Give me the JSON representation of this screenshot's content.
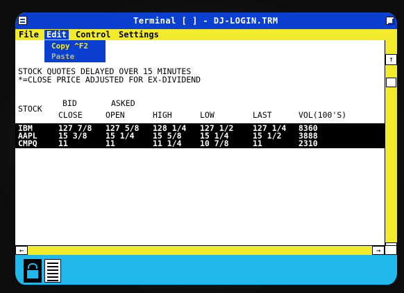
{
  "window": {
    "title": "Terminal  [  ] - DJ-LOGIN.TRM"
  },
  "menubar": {
    "items": [
      "File",
      "Edit",
      "Control",
      "Settings"
    ],
    "active": "Edit"
  },
  "edit_menu": {
    "copy_label": "Copy  ^F2",
    "paste_label": "Paste"
  },
  "content": {
    "notice_line1": "STOCK QUOTES DELAYED OVER 15 MINUTES",
    "notice_line2": "*=CLOSE PRICE ADJUSTED FOR EX-DIVIDEND",
    "header_top": {
      "bid": "BID",
      "asked": "ASKED"
    },
    "header_bottom": {
      "stock": "STOCK",
      "close": "CLOSE",
      "open": "OPEN",
      "high": "HIGH",
      "low": "LOW",
      "last": "LAST",
      "vol": "VOL(100'S)"
    },
    "rows": [
      {
        "stock": "IBM",
        "close": "127 7/8",
        "open": "127 5/8",
        "high": "128 1/4",
        "low": "127  1/2",
        "last": "127 1/4",
        "vol": "8360"
      },
      {
        "stock": "AAPL",
        "close": "15 3/8",
        "open": "15 1/4",
        "high": "15 5/8",
        "low": "15 1/4",
        "last": "15 1/2",
        "vol": "3888"
      },
      {
        "stock": "CMPQ",
        "close": "11",
        "open": "11",
        "high": "11 1/4",
        "low": "10 7/8",
        "last": "11",
        "vol": "2310"
      }
    ]
  },
  "scrollbars": {
    "up_arrow": "↑",
    "down_arrow": "↓",
    "left_arrow": "←",
    "right_arrow": "→"
  },
  "icons": [
    "terminal-icon",
    "notepad-icon"
  ],
  "colors": {
    "titlebar": "#0b3fcf",
    "menubar": "#f2ea2c",
    "iconbar": "#20b8ea",
    "highlight_rows": "#000000"
  }
}
